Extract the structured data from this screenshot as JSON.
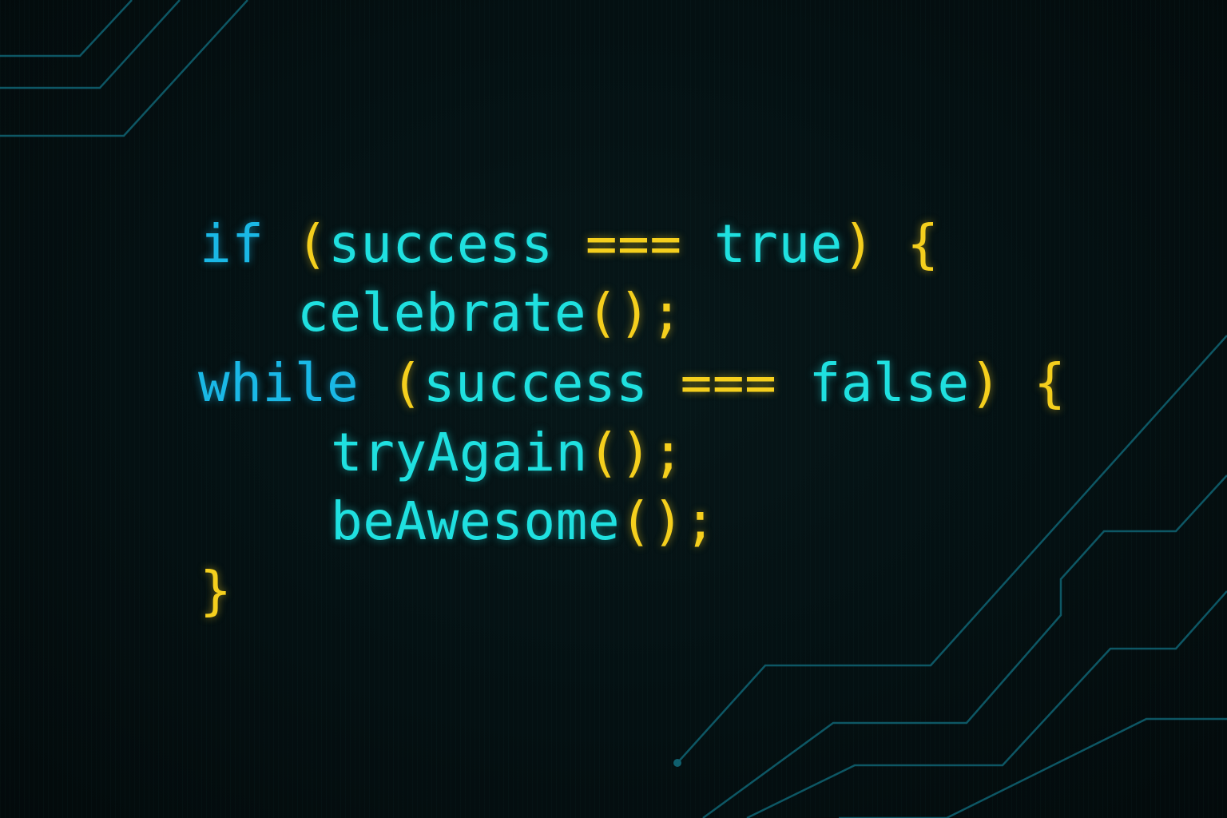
{
  "colors": {
    "background": "#040d0e",
    "keyword": "#1ab8e6",
    "identifier": "#1fe0e0",
    "punctuation": "#f5cf1d",
    "trace": "#0f5f6e"
  },
  "code": {
    "line1": {
      "keyword": "if",
      "open_paren": "(",
      "condition_var": "success",
      "operator": "===",
      "value": "true",
      "close_paren": ")",
      "brace": "{"
    },
    "line2": {
      "func": "celebrate",
      "call": "();"
    },
    "line3": {
      "keyword": "while",
      "open_paren": "(",
      "condition_var": "success",
      "operator": "===",
      "value": "false",
      "close_paren": ")",
      "brace": "{"
    },
    "line4": {
      "func": "tryAgain",
      "call": "();"
    },
    "line5": {
      "func": "beAwesome",
      "call": "();"
    },
    "line6": {
      "brace": "}"
    }
  }
}
